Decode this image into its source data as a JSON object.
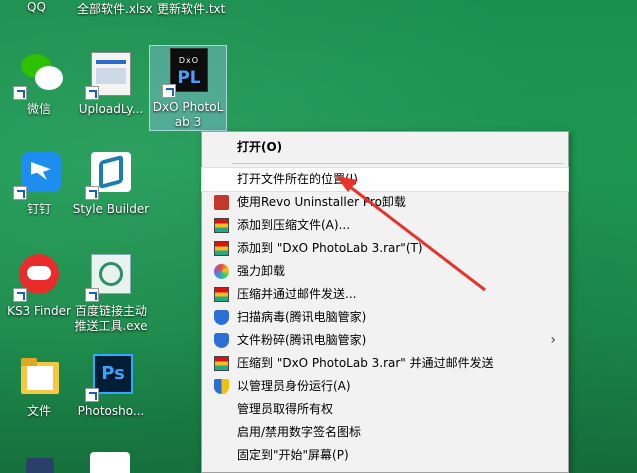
{
  "desktop": {
    "top_labels": [
      "QQ",
      "全部软件.xlsx",
      "更新软件.txt"
    ],
    "icons": [
      {
        "label": "微信"
      },
      {
        "label": "UploadLy..."
      },
      {
        "label": "DxO PhotoLab 3"
      },
      {
        "label": "钉钉"
      },
      {
        "label": "Style Builder"
      },
      {
        "label": "KS3 Finder"
      },
      {
        "label": "百度链接主动推送工具.exe"
      },
      {
        "label": "文件"
      },
      {
        "label": "Photosho..."
      }
    ]
  },
  "context_menu": {
    "items": [
      {
        "label": "打开(O)"
      },
      {
        "label": "打开文件所在的位置(I)"
      },
      {
        "label": "使用Revo Uninstaller Pro卸载"
      },
      {
        "label": "添加到压缩文件(A)..."
      },
      {
        "label": "添加到 \"DxO PhotoLab 3.rar\"(T)"
      },
      {
        "label": "强力卸载"
      },
      {
        "label": "压缩并通过邮件发送..."
      },
      {
        "label": "扫描病毒(腾讯电脑管家)"
      },
      {
        "label": "文件粉碎(腾讯电脑管家)"
      },
      {
        "label": "压缩到 \"DxO PhotoLab 3.rar\" 并通过邮件发送"
      },
      {
        "label": "以管理员身份运行(A)"
      },
      {
        "label": "管理员取得所有权"
      },
      {
        "label": "启用/禁用数字签名图标"
      },
      {
        "label": "固定到\"开始\"屏幕(P)"
      }
    ]
  },
  "colors": {
    "desktop_bg": "#1c8c4c",
    "menu_bg": "#f2f2f2",
    "annotation_arrow": "#e8332a"
  }
}
